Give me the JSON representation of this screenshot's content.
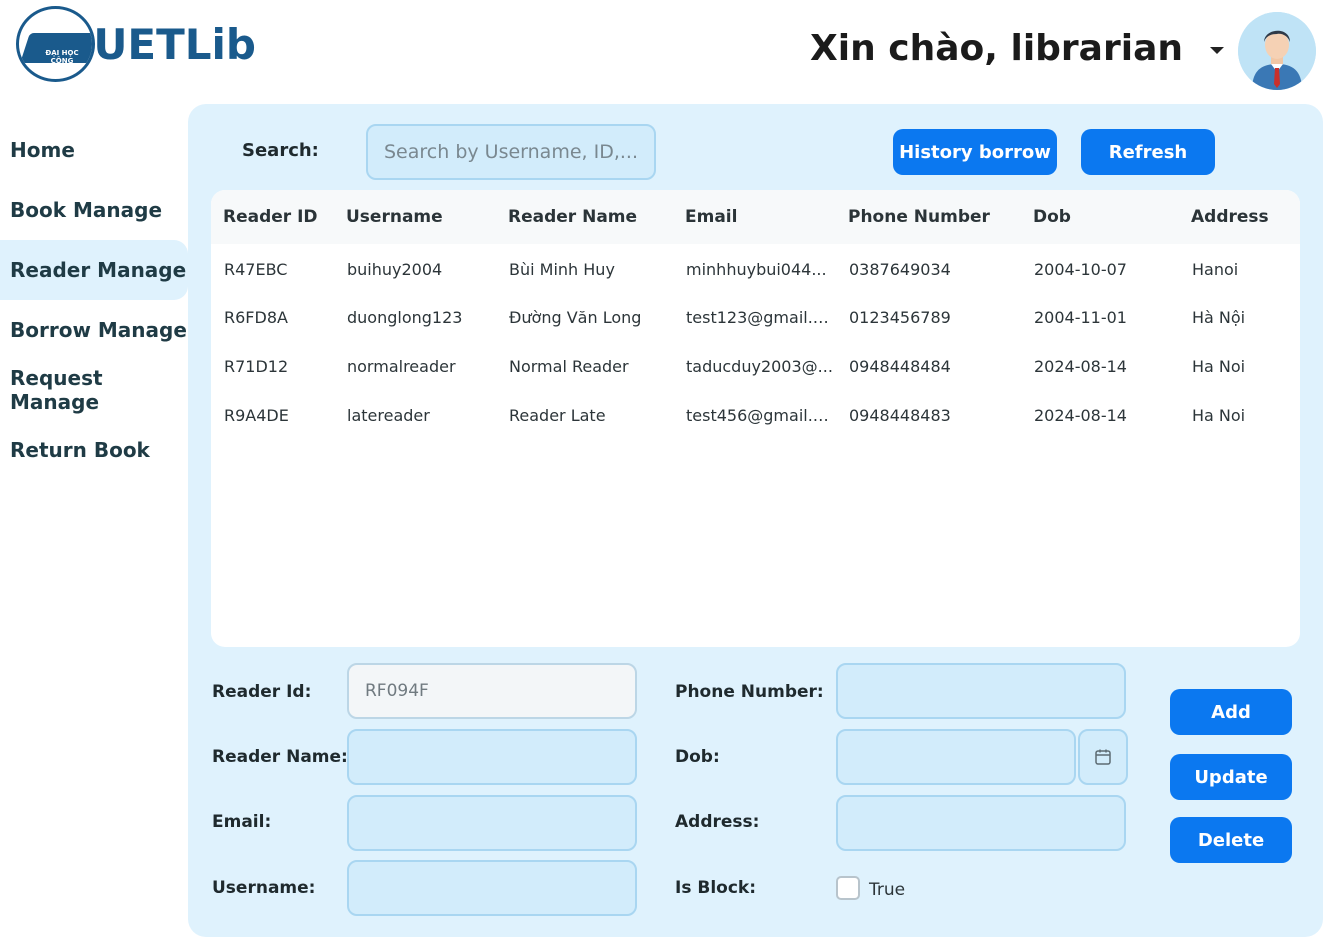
{
  "header": {
    "logo_text": "UETLib",
    "logo_sub": "ĐẠI HỌC CÔNG NGHỆ",
    "greeting": "Xin chào, librarian"
  },
  "sidebar": {
    "items": [
      {
        "label": "Home"
      },
      {
        "label": "Book Manage"
      },
      {
        "label": "Reader Manage",
        "active": true
      },
      {
        "label": "Borrow Manage"
      },
      {
        "label": "Request Manage"
      },
      {
        "label": "Return Book"
      }
    ]
  },
  "search": {
    "label": "Search:",
    "placeholder": "Search by Username, ID,..."
  },
  "toolbar": {
    "history_label": "History borrow",
    "refresh_label": "Refresh"
  },
  "table": {
    "columns": [
      "Reader ID",
      "Username",
      "Reader Name",
      "Email",
      "Phone Number",
      "Dob",
      "Address"
    ],
    "rows": [
      [
        "R47EBC",
        "buihuy2004",
        "Bùi Minh Huy",
        "minhhuybui044...",
        "0387649034",
        "2004-10-07",
        "Hanoi"
      ],
      [
        "R6FD8A",
        "duonglong123",
        "Đường Văn Long",
        "test123@gmail.c...",
        "0123456789",
        "2004-11-01",
        "Hà Nội"
      ],
      [
        "R71D12",
        "normalreader",
        "Normal Reader",
        "taducduy2003@...",
        "0948448484",
        "2024-08-14",
        "Ha Noi"
      ],
      [
        "R9A4DE",
        "latereader",
        "Reader Late",
        "test456@gmail.c...",
        "0948448483",
        "2024-08-14",
        "Ha Noi"
      ]
    ]
  },
  "form": {
    "reader_id_label": "Reader Id:",
    "reader_id_value": "RF094F",
    "reader_name_label": "Reader Name:",
    "email_label": "Email:",
    "username_label": "Username:",
    "phone_label": "Phone Number:",
    "dob_label": "Dob:",
    "address_label": "Address:",
    "is_block_label": "Is Block:",
    "is_block_option": "True",
    "is_block_checked": false
  },
  "actions": {
    "add_label": "Add",
    "update_label": "Update",
    "delete_label": "Delete"
  },
  "colors": {
    "accent": "#0b78f0",
    "panel": "#dff2fd",
    "input_bg": "#d2ecfb",
    "brand": "#1a5a8c"
  }
}
